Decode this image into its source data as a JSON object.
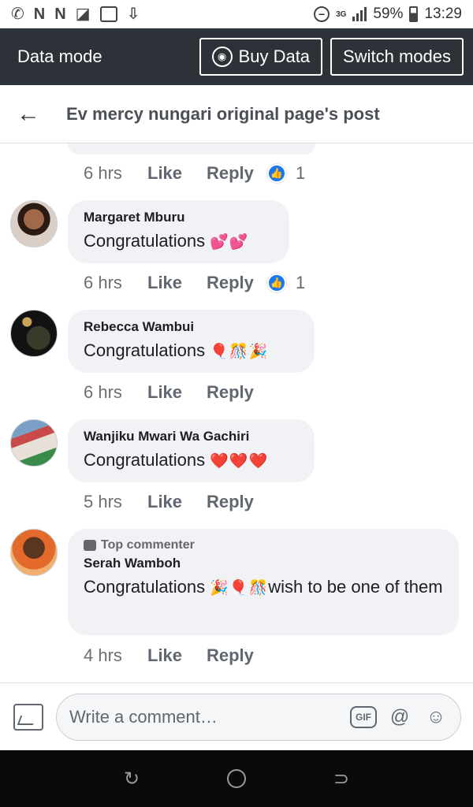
{
  "status_bar": {
    "left_icons": [
      "whatsapp-icon",
      "notification-n-icon",
      "notification-n-icon",
      "tag-icon",
      "image-icon",
      "download-icon"
    ],
    "network": "3G",
    "battery": "59%",
    "time": "13:29"
  },
  "data_mode_bar": {
    "label": "Data mode",
    "buy_data": "Buy Data",
    "switch_modes": "Switch modes"
  },
  "header": {
    "title": "Ev mercy nungari original page's post"
  },
  "previous_comment": {
    "time": "6 hrs",
    "like": "Like",
    "reply": "Reply",
    "reactions": "1"
  },
  "comments": [
    {
      "author": "Margaret Mburu",
      "text": "Congratulations",
      "emoji": "💕💕",
      "time": "6 hrs",
      "like": "Like",
      "reply": "Reply",
      "reactions": "1"
    },
    {
      "author": "Rebecca Wambui",
      "text": "Congratulations",
      "emoji": "🎈🎊🎉",
      "time": "6 hrs",
      "like": "Like",
      "reply": "Reply"
    },
    {
      "author": "Wanjiku Mwari Wa Gachiri",
      "text": "Congratulations",
      "emoji": "❤️❤️❤️",
      "time": "5 hrs",
      "like": "Like",
      "reply": "Reply"
    },
    {
      "badge": "Top commenter",
      "author": "Serah Wamboh",
      "text_before": "Congratulations",
      "emoji": "🎉🎈🎊",
      "text_after": "wish to be one of them",
      "time": "4 hrs",
      "like": "Like",
      "reply": "Reply"
    }
  ],
  "composer": {
    "placeholder": "Write a comment…",
    "gif": "GIF"
  }
}
